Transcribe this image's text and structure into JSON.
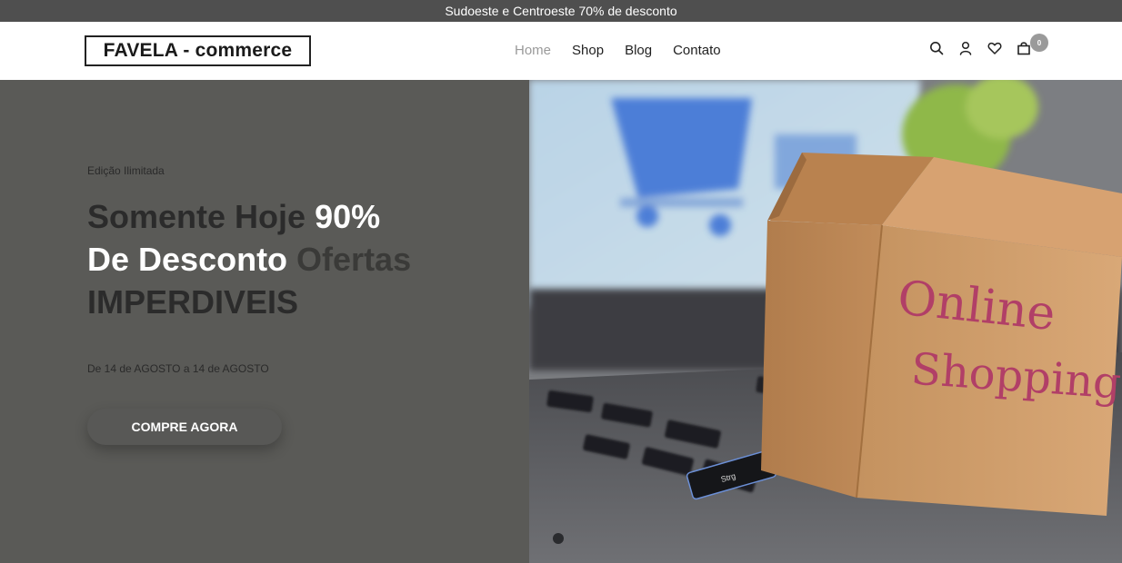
{
  "topbar": {
    "text": "Sudoeste e Centroeste 70% de desconto"
  },
  "header": {
    "logo": "FAVELA - commerce",
    "nav": [
      "Home",
      "Shop",
      "Blog",
      "Contato"
    ],
    "icons": [
      "search-icon",
      "user-icon",
      "heart-icon",
      "bag-icon"
    ],
    "cart_count": "0"
  },
  "hero": {
    "eyebrow": "Edição Ilimitada",
    "headline": {
      "part1": "Somente Hoje ",
      "part2": "90%",
      "part3": "De Desconto",
      "part4": " Ofertas",
      "part5": "IMPERDIVEIS"
    },
    "dates": "De 14 de AGOSTO a 14 de AGOSTO",
    "cta": "COMPRE AGORA",
    "image_text": [
      "Online",
      "Shopping"
    ]
  },
  "colors": {
    "topbar": "#4f4f4f",
    "hero_bg": "#5a5a57",
    "nav_active": "#9a9a9a",
    "cta_bg": "#585856"
  }
}
